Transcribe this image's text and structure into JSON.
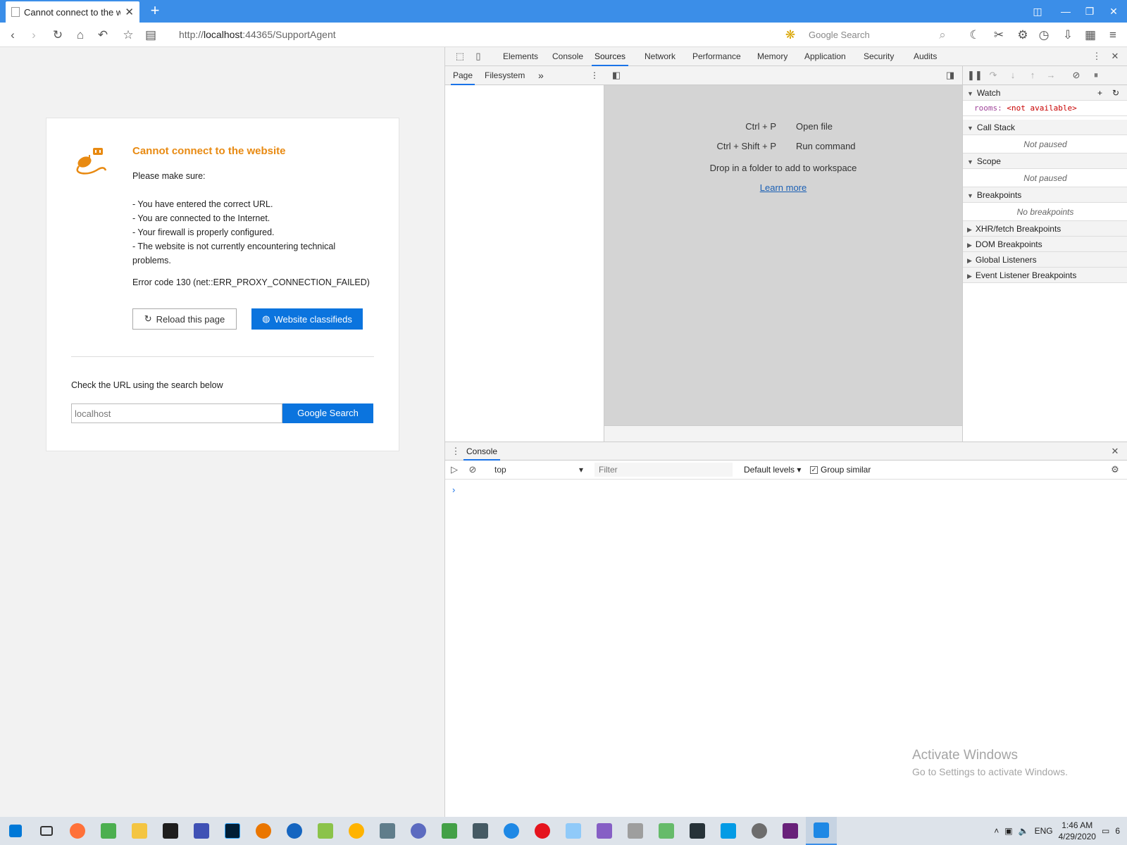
{
  "browser": {
    "tab_title": "Cannot connect to the w",
    "url_prefix": "http://",
    "url_host": "localhost",
    "url_rest": ":44365/SupportAgent",
    "search_placeholder": "Google Search"
  },
  "error_page": {
    "title": "Cannot connect to the website",
    "make_sure": "Please make sure:",
    "reasons": [
      "- You have entered the correct URL.",
      "- You are connected to the Internet.",
      "- Your firewall is properly configured.",
      "- The website is not currently encountering technical problems."
    ],
    "error_code": "Error code 130 (net::ERR_PROXY_CONNECTION_FAILED)",
    "reload_label": "Reload this page",
    "classifieds_label": "Website classifieds",
    "check_url": "Check the URL using the search below",
    "search_value": "localhost",
    "search_button": "Google Search",
    "accent_color": "#e88a12",
    "button_color": "#0b74de"
  },
  "devtools": {
    "tabs": [
      "Elements",
      "Console",
      "Sources",
      "Network",
      "Performance",
      "Memory",
      "Application",
      "Security",
      "Audits"
    ],
    "active_tab": "Sources",
    "navigator_tabs": [
      "Page",
      "Filesystem"
    ],
    "shortcuts": [
      {
        "key": "Ctrl + P",
        "label": "Open file"
      },
      {
        "key": "Ctrl + Shift + P",
        "label": "Run command"
      }
    ],
    "drop_text": "Drop in a folder to add to workspace",
    "learn_more": "Learn more",
    "watch": {
      "title": "Watch",
      "expr_key": "rooms:",
      "expr_value": "<not available>"
    },
    "call_stack": {
      "title": "Call Stack",
      "body": "Not paused"
    },
    "scope": {
      "title": "Scope",
      "body": "Not paused"
    },
    "breakpoints": {
      "title": "Breakpoints",
      "body": "No breakpoints"
    },
    "collapsed_sections": [
      "XHR/fetch Breakpoints",
      "DOM Breakpoints",
      "Global Listeners",
      "Event Listener Breakpoints"
    ],
    "drawer_tab": "Console",
    "context": "top",
    "filter_placeholder": "Filter",
    "levels": "Default levels",
    "group_similar": "Group similar"
  },
  "watermark": {
    "title": "Activate Windows",
    "subtitle": "Go to Settings to activate Windows."
  },
  "taskbar": {
    "language": "ENG",
    "time": "1:46 AM",
    "date": "4/29/2020",
    "notification_count": "6",
    "apps": [
      "firefox",
      "app2",
      "file-explorer",
      "terminal",
      "app5",
      "photoshop",
      "blender",
      "app8",
      "app9",
      "app10",
      "app11",
      "app12",
      "app13",
      "app14",
      "app15",
      "opera",
      "app17",
      "visual-studio",
      "app19",
      "app20",
      "app21",
      "app22",
      "app23",
      "visual-studio-2",
      "app25"
    ]
  }
}
